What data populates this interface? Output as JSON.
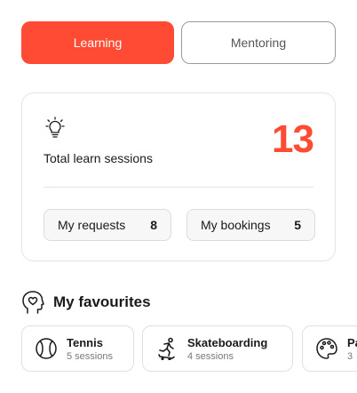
{
  "tabs": [
    {
      "label": "Learning"
    },
    {
      "label": "Mentoring"
    }
  ],
  "stats": {
    "icon": "lightbulb-icon",
    "label": "Total learn sessions",
    "count": "13",
    "requests": {
      "label": "My requests",
      "count": "8"
    },
    "bookings": {
      "label": "My bookings",
      "count": "5"
    }
  },
  "favourites": {
    "title": "My favourites",
    "icon": "heart-head-icon",
    "items": [
      {
        "name": "Tennis",
        "sessions": "5 sessions",
        "icon": "tennis-ball-icon"
      },
      {
        "name": "Skateboarding",
        "sessions": "4 sessions",
        "icon": "skateboarding-icon"
      },
      {
        "name": "Pa",
        "sessions": "3",
        "icon": "palette-icon"
      }
    ]
  },
  "colors": {
    "accent": "#ff4b33"
  }
}
